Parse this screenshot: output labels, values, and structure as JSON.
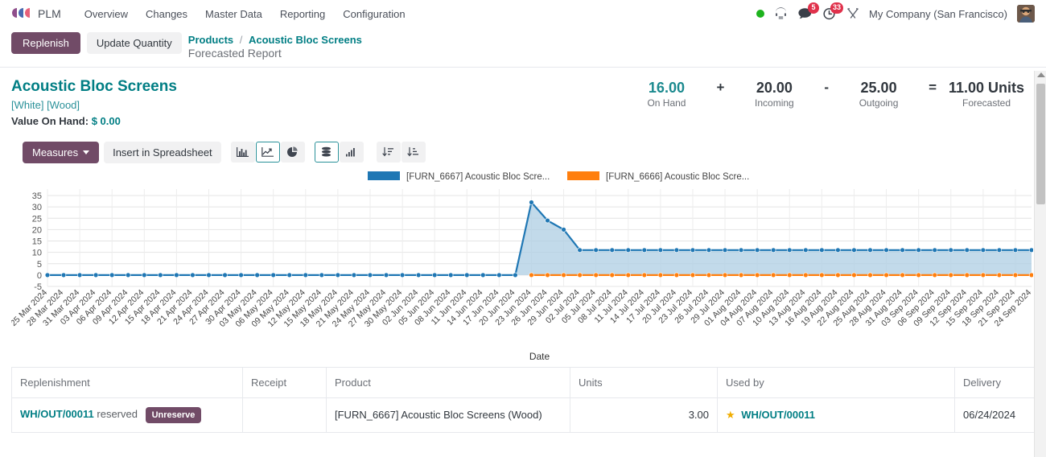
{
  "navbar": {
    "brand": "PLM",
    "menu": [
      "Overview",
      "Changes",
      "Master Data",
      "Reporting",
      "Configuration"
    ],
    "messages_badge": "5",
    "activities_badge": "33",
    "company": "My Company (San Francisco)"
  },
  "control_panel": {
    "replenish_label": "Replenish",
    "update_quantity_label": "Update Quantity",
    "breadcrumb_root": "Products",
    "breadcrumb_sep": "/",
    "breadcrumb_current": "Acoustic Bloc Screens",
    "breadcrumb_subtitle": "Forecasted Report"
  },
  "record": {
    "title": "Acoustic Bloc Screens",
    "variant": "[White] [Wood]",
    "value_on_hand_label": "Value On Hand:",
    "value_on_hand_amount": "$ 0.00",
    "stats": [
      {
        "value": "16.00",
        "label": "On Hand",
        "op_after": "+"
      },
      {
        "value": "20.00",
        "label": "Incoming",
        "op_after": "-"
      },
      {
        "value": "25.00",
        "label": "Outgoing",
        "op_after": "="
      },
      {
        "value": "11.00 Units",
        "label": "Forecasted",
        "op_after": ""
      }
    ]
  },
  "toolbar": {
    "measures_label": "Measures",
    "insert_spreadsheet_label": "Insert in Spreadsheet",
    "view_buttons": [
      {
        "icon": "bar-chart-icon",
        "active": false
      },
      {
        "icon": "line-chart-icon",
        "active": true
      },
      {
        "icon": "pie-chart-icon",
        "active": false
      }
    ],
    "mode_buttons": [
      {
        "icon": "stacked-icon",
        "active": true
      },
      {
        "icon": "ascending-bars-icon",
        "active": false
      }
    ],
    "sort_buttons": [
      {
        "icon": "sort-descending-icon",
        "active": false
      },
      {
        "icon": "sort-ascending-icon",
        "active": false
      }
    ]
  },
  "chart_data": {
    "type": "area",
    "title": "",
    "xlabel": "Date",
    "ylabel": "",
    "ylim": [
      -5,
      35
    ],
    "yticks": [
      -5,
      0,
      5,
      10,
      15,
      20,
      25,
      30,
      35
    ],
    "grid": true,
    "legend_position": "top",
    "legend": [
      {
        "name": "[FURN_6667] Acoustic Bloc Scre...",
        "color": "#1f77b4"
      },
      {
        "name": "[FURN_6666] Acoustic Bloc Scre...",
        "color": "#ff7f0e"
      }
    ],
    "categories": [
      "25 Mar 2024",
      "28 Mar 2024",
      "31 Mar 2024",
      "03 Apr 2024",
      "06 Apr 2024",
      "09 Apr 2024",
      "12 Apr 2024",
      "15 Apr 2024",
      "18 Apr 2024",
      "21 Apr 2024",
      "24 Apr 2024",
      "27 Apr 2024",
      "30 Apr 2024",
      "03 May 2024",
      "06 May 2024",
      "09 May 2024",
      "12 May 2024",
      "15 May 2024",
      "18 May 2024",
      "21 May 2024",
      "24 May 2024",
      "27 May 2024",
      "30 May 2024",
      "02 Jun 2024",
      "05 Jun 2024",
      "08 Jun 2024",
      "11 Jun 2024",
      "14 Jun 2024",
      "17 Jun 2024",
      "20 Jun 2024",
      "23 Jun 2024",
      "26 Jun 2024",
      "29 Jun 2024",
      "02 Jul 2024",
      "05 Jul 2024",
      "08 Jul 2024",
      "11 Jul 2024",
      "14 Jul 2024",
      "17 Jul 2024",
      "20 Jul 2024",
      "23 Jul 2024",
      "26 Jul 2024",
      "29 Jul 2024",
      "01 Aug 2024",
      "04 Aug 2024",
      "07 Aug 2024",
      "10 Aug 2024",
      "13 Aug 2024",
      "16 Aug 2024",
      "19 Aug 2024",
      "22 Aug 2024",
      "25 Aug 2024",
      "28 Aug 2024",
      "31 Aug 2024",
      "03 Sep 2024",
      "06 Sep 2024",
      "09 Sep 2024",
      "12 Sep 2024",
      "15 Sep 2024",
      "18 Sep 2024",
      "21 Sep 2024",
      "24 Sep 2024"
    ],
    "series": [
      {
        "name": "[FURN_6667] Acoustic Bloc Scre...",
        "color": "#1f77b4",
        "fill": "#aecde3",
        "values": [
          0,
          0,
          0,
          0,
          0,
          0,
          0,
          0,
          0,
          0,
          0,
          0,
          0,
          0,
          0,
          0,
          0,
          0,
          0,
          0,
          0,
          0,
          0,
          0,
          0,
          0,
          0,
          0,
          0,
          0,
          32,
          24,
          20,
          11,
          11,
          11,
          11,
          11,
          11,
          11,
          11,
          11,
          11,
          11,
          11,
          11,
          11,
          11,
          11,
          11,
          11,
          11,
          11,
          11,
          11,
          11,
          11,
          11,
          11,
          11,
          11,
          11
        ]
      },
      {
        "name": "[FURN_6666] Acoustic Bloc Scre...",
        "color": "#ff7f0e",
        "fill": "#ffbe7d",
        "values": [
          null,
          null,
          null,
          null,
          null,
          null,
          null,
          null,
          null,
          null,
          null,
          null,
          null,
          null,
          null,
          null,
          null,
          null,
          null,
          null,
          null,
          null,
          null,
          null,
          null,
          null,
          null,
          null,
          null,
          null,
          0,
          0,
          0,
          0,
          0,
          0,
          0,
          0,
          0,
          0,
          0,
          0,
          0,
          0,
          0,
          0,
          0,
          0,
          0,
          0,
          0,
          0,
          0,
          0,
          0,
          0,
          0,
          0,
          0,
          0,
          0,
          0
        ]
      }
    ]
  },
  "table": {
    "columns": [
      "Replenishment",
      "Receipt",
      "Product",
      "Units",
      "Used by",
      "Delivery"
    ],
    "rows": [
      {
        "replenishment_link": "WH/OUT/00011",
        "replenishment_status": "reserved",
        "replenishment_action": "Unreserve",
        "receipt": "",
        "product": "[FURN_6667] Acoustic Bloc Screens (Wood)",
        "units": "3.00",
        "used_by_icon": "star-icon",
        "used_by": "WH/OUT/00011",
        "delivery": "06/24/2024"
      }
    ]
  }
}
